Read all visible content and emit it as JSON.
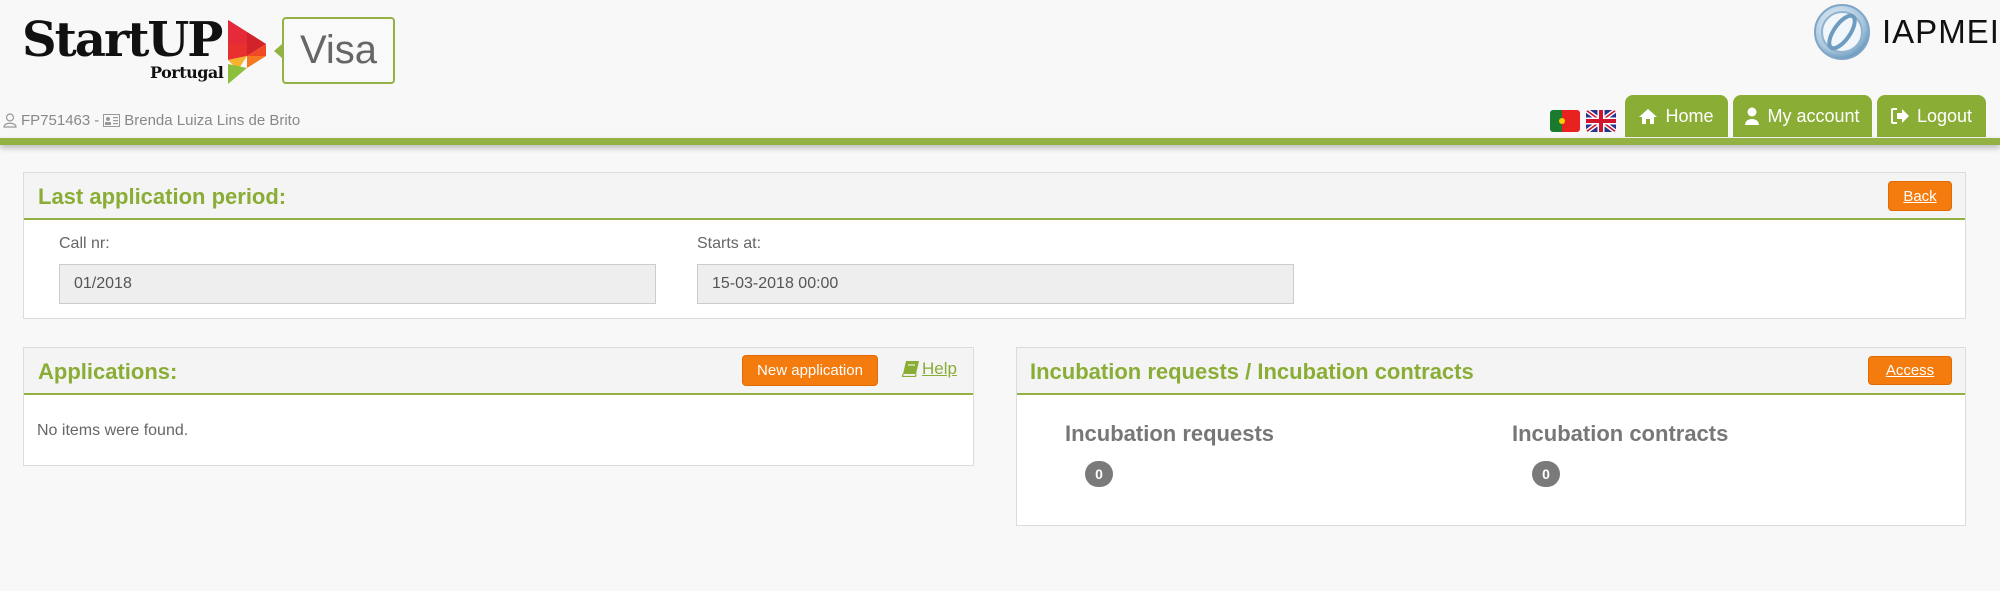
{
  "header": {
    "logo_main": "StartUP",
    "logo_sub": "Portugal",
    "product_label": "Visa",
    "partner_logo": "IAPMEI",
    "user": {
      "id": "FP751463",
      "separator": "-",
      "name": "Brenda Luiza Lins de Brito"
    },
    "languages": [
      {
        "code": "pt",
        "icon": "flag-portugal-icon"
      },
      {
        "code": "en",
        "icon": "flag-uk-icon"
      }
    ],
    "nav": {
      "home": "Home",
      "account": "My account",
      "logout": "Logout"
    }
  },
  "period_panel": {
    "title": "Last application period:",
    "back_label": "Back",
    "call_label": "Call nr:",
    "call_value": "01/2018",
    "starts_label": "Starts at:",
    "starts_value": "15-03-2018 00:00"
  },
  "applications_panel": {
    "title": "Applications:",
    "new_label": "New application",
    "help_label": "Help",
    "empty_message": "No items were found."
  },
  "incubation_panel": {
    "title": "Incubation requests / Incubation contracts",
    "access_label": "Access",
    "requests_label": "Incubation requests",
    "requests_count": "0",
    "contracts_label": "Incubation contracts",
    "contracts_count": "0"
  },
  "colors": {
    "brand_green": "#8aad36",
    "accent_orange": "#f47b0d",
    "badge_gray": "#7a7a7a"
  }
}
